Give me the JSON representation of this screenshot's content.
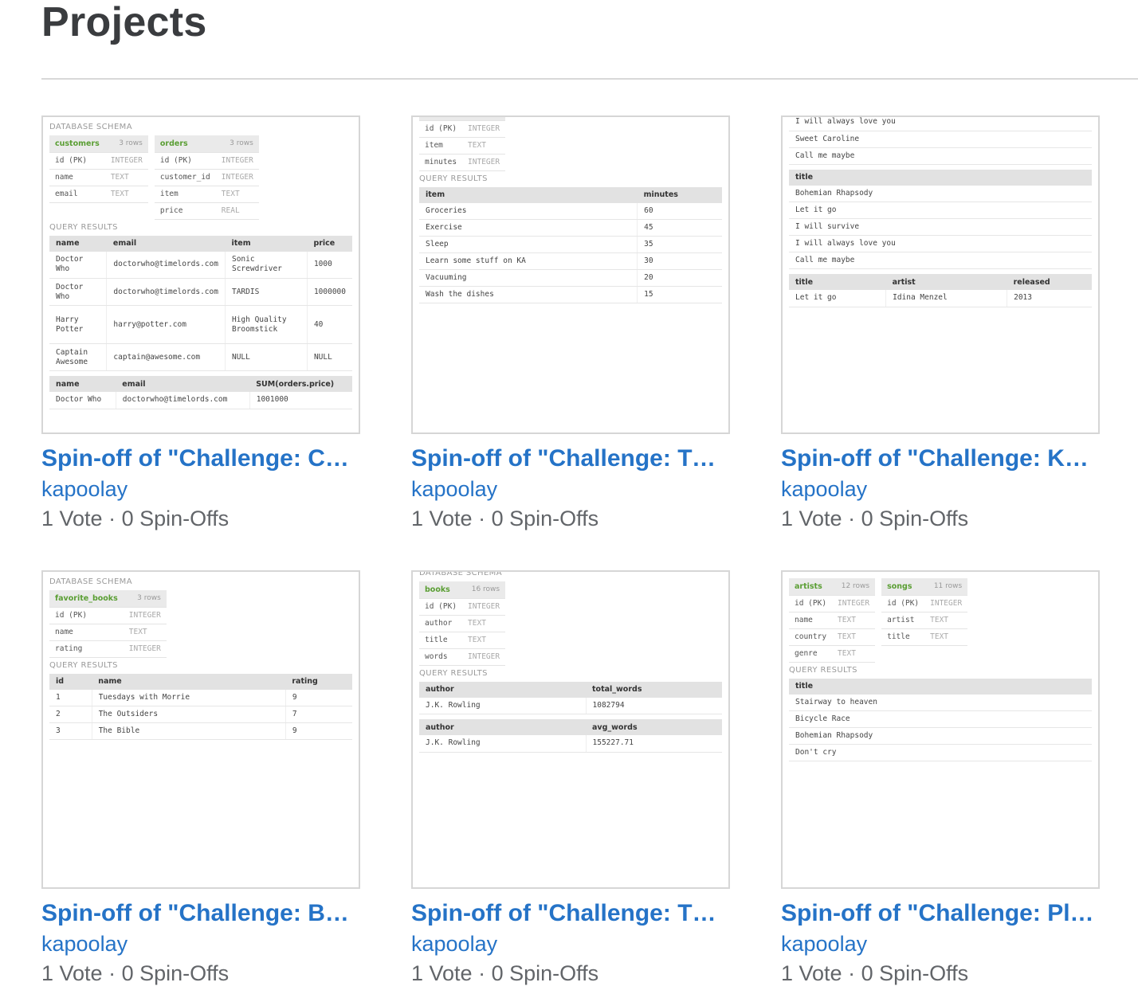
{
  "page": {
    "title": "Projects"
  },
  "projects": [
    {
      "title": "Spin-off of \"Challenge: Cu…",
      "author": "kapoolay",
      "votes": "1 Vote",
      "spinoffs": "0 Spin-Offs",
      "thumb": {
        "labels": [
          "DATABASE SCHEMA",
          "QUERY RESULTS"
        ],
        "tables": [
          {
            "name": "customers",
            "count": "3 rows",
            "rows": [
              [
                "id (PK)",
                "INTEGER"
              ],
              [
                "name",
                "TEXT"
              ],
              [
                "email",
                "TEXT"
              ]
            ]
          },
          {
            "name": "orders",
            "count": "3 rows",
            "rows": [
              [
                "id (PK)",
                "INTEGER"
              ],
              [
                "customer_id",
                "INTEGER"
              ],
              [
                "item",
                "TEXT"
              ],
              [
                "price",
                "REAL"
              ]
            ]
          }
        ],
        "results": [
          {
            "headers": [
              "name",
              "email",
              "item",
              "price"
            ],
            "rows": [
              [
                "Doctor Who",
                "doctorwho@timelords.com",
                "Sonic Screwdriver",
                "1000"
              ],
              [
                "Doctor Who",
                "doctorwho@timelords.com",
                "TARDIS",
                "1000000"
              ],
              [
                "Harry Potter",
                "harry@potter.com",
                "High Quality Broomstick",
                "40"
              ],
              [
                "Captain Awesome",
                "captain@awesome.com",
                "NULL",
                "NULL"
              ]
            ]
          },
          {
            "headers": [
              "name",
              "email",
              "SUM(orders.price)"
            ],
            "rows": [
              [
                "Doctor Who",
                "doctorwho@timelords.com",
                "1001000"
              ]
            ]
          }
        ]
      }
    },
    {
      "title": "Spin-off of \"Challenge: TO…",
      "author": "kapoolay",
      "votes": "1 Vote",
      "spinoffs": "0 Spin-Offs",
      "thumb": {
        "labels": [
          "QUERY RESULTS"
        ],
        "tables": [
          {
            "rows": [
              [
                "id (PK)",
                "INTEGER"
              ],
              [
                "item",
                "TEXT"
              ],
              [
                "minutes",
                "INTEGER"
              ]
            ]
          }
        ],
        "results": [
          {
            "headers": [
              "item",
              "minutes"
            ],
            "rows": [
              [
                "Groceries",
                "60"
              ],
              [
                "Exercise",
                "45"
              ],
              [
                "Sleep",
                "35"
              ],
              [
                "Learn some stuff on KA",
                "30"
              ],
              [
                "Vacuuming",
                "20"
              ],
              [
                "Wash the dishes",
                "15"
              ]
            ]
          }
        ]
      }
    },
    {
      "title": "Spin-off of \"Challenge: Ka…",
      "author": "kapoolay",
      "votes": "1 Vote",
      "spinoffs": "0 Spin-Offs",
      "thumb": {
        "top_rows": [
          "I will always love you",
          "Sweet Caroline",
          "Call me maybe"
        ],
        "results": [
          {
            "headers": [
              "title"
            ],
            "rows": [
              [
                "Bohemian Rhapsody"
              ],
              [
                "Let it go"
              ],
              [
                "I will survive"
              ],
              [
                "I will always love you"
              ],
              [
                "Call me maybe"
              ]
            ]
          },
          {
            "headers": [
              "title",
              "artist",
              "released"
            ],
            "rows": [
              [
                "Let it go",
                "Idina Menzel",
                "2013"
              ]
            ]
          }
        ]
      }
    },
    {
      "title": "Spin-off of \"Challenge: Bo…",
      "author": "kapoolay",
      "votes": "1 Vote",
      "spinoffs": "0 Spin-Offs",
      "thumb": {
        "labels": [
          "DATABASE SCHEMA",
          "QUERY RESULTS"
        ],
        "tables": [
          {
            "name": "favorite_books",
            "count": "3 rows",
            "rows": [
              [
                "id (PK)",
                "INTEGER"
              ],
              [
                "name",
                "TEXT"
              ],
              [
                "rating",
                "INTEGER"
              ]
            ]
          }
        ],
        "results": [
          {
            "headers": [
              "id",
              "name",
              "rating"
            ],
            "rows": [
              [
                "1",
                "Tuesdays with Morrie",
                "9"
              ],
              [
                "2",
                "The Outsiders",
                "7"
              ],
              [
                "3",
                "The Bible",
                "9"
              ]
            ]
          }
        ]
      }
    },
    {
      "title": "Spin-off of \"Challenge: Th…",
      "author": "kapoolay",
      "votes": "1 Vote",
      "spinoffs": "0 Spin-Offs",
      "thumb": {
        "labels": [
          "DATABASE SCHEMA",
          "QUERY RESULTS"
        ],
        "tables": [
          {
            "name": "books",
            "count": "16 rows",
            "rows": [
              [
                "id (PK)",
                "INTEGER"
              ],
              [
                "author",
                "TEXT"
              ],
              [
                "title",
                "TEXT"
              ],
              [
                "words",
                "INTEGER"
              ]
            ]
          }
        ],
        "results": [
          {
            "headers": [
              "author",
              "total_words"
            ],
            "rows": [
              [
                "J.K. Rowling",
                "1082794"
              ]
            ]
          },
          {
            "headers": [
              "author",
              "avg_words"
            ],
            "rows": [
              [
                "J.K. Rowling",
                "155227.71"
              ]
            ]
          }
        ]
      }
    },
    {
      "title": "Spin-off of \"Challenge: Pla…",
      "author": "kapoolay",
      "votes": "1 Vote",
      "spinoffs": "0 Spin-Offs",
      "thumb": {
        "labels": [
          "QUERY RESULTS"
        ],
        "tables": [
          {
            "name": "artists",
            "count": "12 rows",
            "rows": [
              [
                "id (PK)",
                "INTEGER"
              ],
              [
                "name",
                "TEXT"
              ],
              [
                "country",
                "TEXT"
              ],
              [
                "genre",
                "TEXT"
              ]
            ]
          },
          {
            "name": "songs",
            "count": "11 rows",
            "rows": [
              [
                "id (PK)",
                "INTEGER"
              ],
              [
                "artist",
                "TEXT"
              ],
              [
                "title",
                "TEXT"
              ]
            ]
          }
        ],
        "results": [
          {
            "headers": [
              "title"
            ],
            "rows": [
              [
                "Stairway to heaven"
              ],
              [
                "Bicycle Race"
              ],
              [
                "Bohemian Rhapsody"
              ],
              [
                "Don't cry"
              ]
            ]
          }
        ]
      }
    }
  ]
}
